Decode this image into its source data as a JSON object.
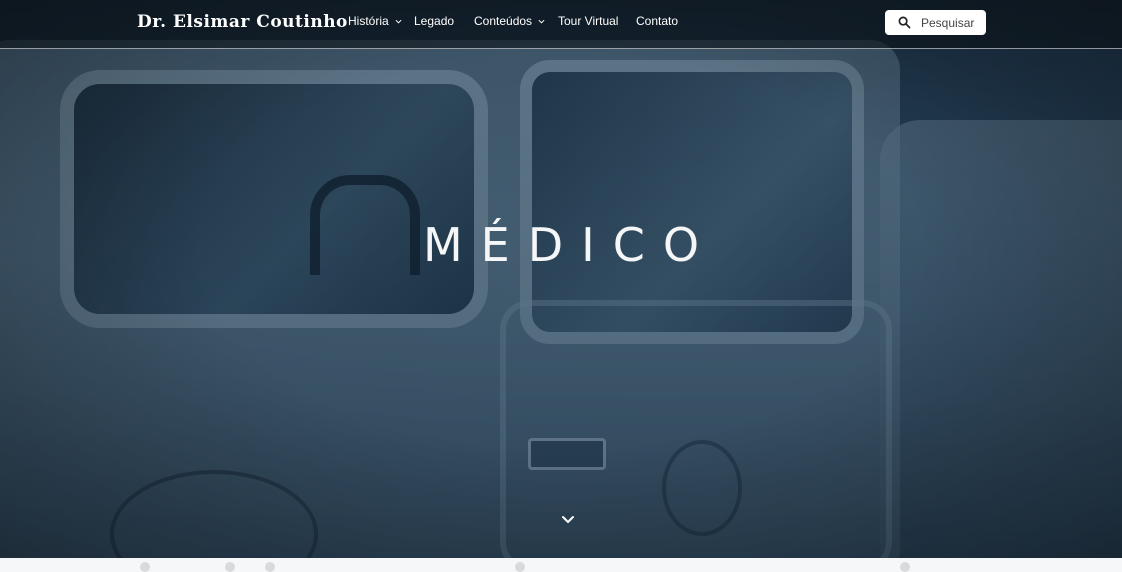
{
  "header": {
    "brand": "Dr. Elsimar Coutinho",
    "nav": [
      {
        "label": "História",
        "dropdown": true
      },
      {
        "label": "Legado",
        "dropdown": false
      },
      {
        "label": "Conteúdos",
        "dropdown": true
      },
      {
        "label": "Tour Virtual",
        "dropdown": false
      },
      {
        "label": "Contato",
        "dropdown": false
      }
    ],
    "search": {
      "placeholder": "Pesquisar",
      "icon": "search-icon"
    }
  },
  "hero": {
    "title": "MÉDICO",
    "scroll_icon": "chevron-down-icon"
  },
  "colors": {
    "header_bg": "#0a0e12",
    "text": "#ffffff",
    "hero_tint": "#2c4558"
  }
}
